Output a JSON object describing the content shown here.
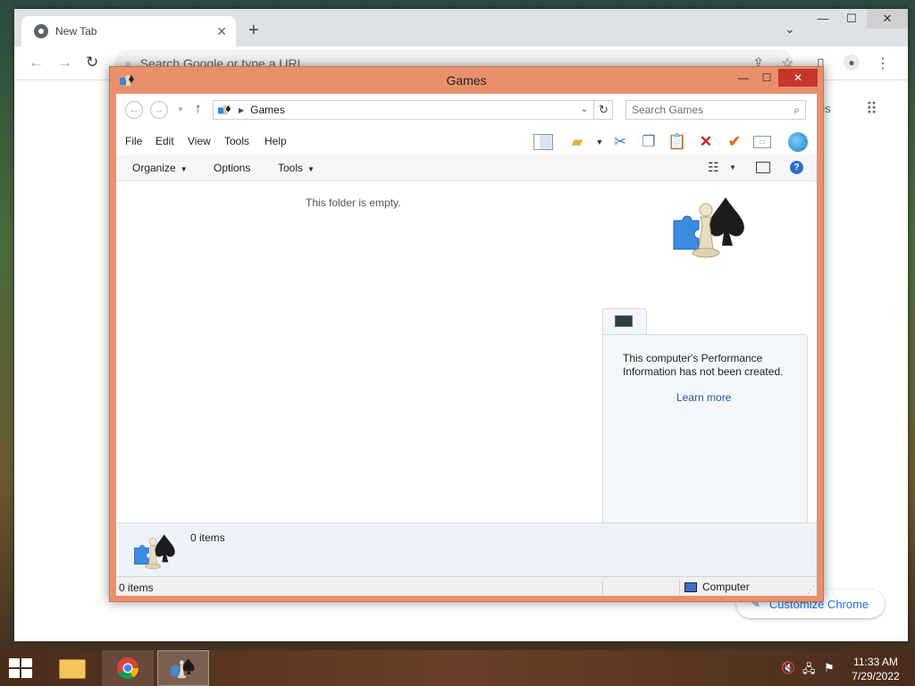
{
  "chrome": {
    "tab_title": "New Tab",
    "tab_close": "✕",
    "new_tab": "+",
    "tab_search": "⌄",
    "minimize": "—",
    "maximize": "☐",
    "close": "✕",
    "omnibox_placeholder": "Search Google or type a URL",
    "behind_text": "es",
    "customize_label": "Customize Chrome"
  },
  "games": {
    "title": "Games",
    "minimize": "—",
    "maximize": "☐",
    "close": "✕",
    "address": "Games",
    "search_placeholder": "Search Games",
    "menu": [
      "File",
      "Edit",
      "View",
      "Tools",
      "Help"
    ],
    "commands": {
      "organize": "Organize",
      "options": "Options",
      "tools": "Tools"
    },
    "empty_message": "This folder is empty.",
    "performance": {
      "text": "This computer's Performance Information has not been created.",
      "link": "Learn more"
    },
    "details_count": "0 items",
    "status_count": "0 items",
    "status_location": "Computer"
  },
  "taskbar": {
    "time": "11:33 AM",
    "date": "7/29/2022"
  },
  "icons": [
    "chrome-icon",
    "folder-icon",
    "games-icon",
    "puzzle-icon",
    "chess-pawn-icon",
    "spade-icon",
    "scissors-icon",
    "copy-icon",
    "paste-icon",
    "delete-icon",
    "check-icon",
    "windows-start-icon",
    "speaker-muted-icon",
    "network-icon",
    "flag-icon"
  ]
}
